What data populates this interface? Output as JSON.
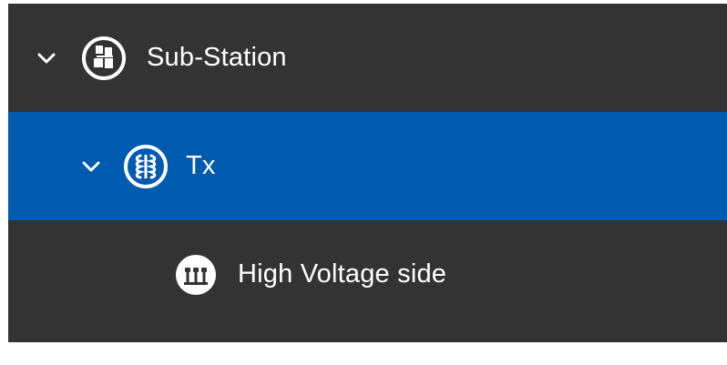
{
  "tree": {
    "items": [
      {
        "label": "Sub-Station",
        "icon": "substation-icon",
        "expanded": true,
        "selected": false
      },
      {
        "label": "Tx",
        "icon": "transformer-icon",
        "expanded": true,
        "selected": true
      },
      {
        "label": "High Voltage side",
        "icon": "high-voltage-side-icon",
        "expanded": false,
        "selected": false
      }
    ]
  },
  "colors": {
    "background": "#333333",
    "selected_row": "#005aad",
    "text": "#ffffff"
  }
}
